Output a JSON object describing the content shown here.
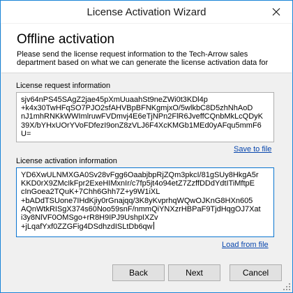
{
  "window": {
    "title": "License Activation Wizard"
  },
  "header": {
    "heading": "Offline activation",
    "description": "Please send the license request information to the Tech-Arrow sales department based on what we can generate the license activation data for"
  },
  "request": {
    "label": "License request information",
    "lines": [
      "sjv64nPS45SAgZ2jae45pXmUuaahSt9neZWi0t3KDl4p",
      "+k4x30TwHFqSO7PJO2sfAHVBpBFNKgmjxO/5wlkbC8D5zhNhAoD",
      "nJ1mhRNKkWWImlruwFVDmvj4E6eTjNPn2FlR6JveffCQnbMkLcQDyK",
      "39X/bYHxUOrYVoFDfezI9onZ8zVLJ6F4XcKMGb1MEd0yAFqu5mmF6",
      "U="
    ],
    "save_link": "Save to file"
  },
  "activation": {
    "label": "License activation information",
    "lines": [
      "YD6XwULNMXGA0Sv28vFgg6OaabjbpRjZQm3pkcI/81gSUy8HkgA5r",
      "KKD0rX9ZMcIkFpr2ExeHIMxnIr/c7fp5jt4o94etZ7ZzffDDdYdtITiMftpE",
      "cInGoea2TQuK+7Chh6Ghh7Z+y9W1iXL",
      "+bADdTSUone7IHdKjiy0rGnajqq/3K8yKvprhqWQwOJKnG8HXn605",
      "AQnWtkRISgX374s60Noo59snF/nmmQiYNXzrHBPaF9TjdHqgOJ7Xat",
      "i3y8NlVF0OMSgo+rR8H9IPJ9UshpIXZv",
      "+jLqafYxf0ZZGFig4DSdhzdISLtDb6qw"
    ],
    "load_link": "Load from file"
  },
  "buttons": {
    "back": "Back",
    "next": "Next",
    "cancel": "Cancel"
  }
}
